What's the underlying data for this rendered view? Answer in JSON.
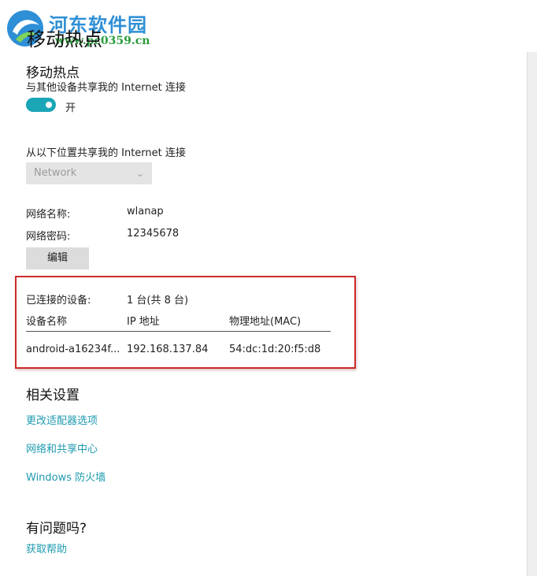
{
  "watermark": {
    "site_name": "河东软件园",
    "url": "www.pc0359.cn"
  },
  "page": {
    "title": "移动热点"
  },
  "hotspot": {
    "section_title": "移动热点",
    "share_label": "与其他设备共享我的 Internet 连接",
    "toggle_state": "开",
    "share_from_label": "从以下位置共享我的 Internet 连接",
    "share_from_value": "Network"
  },
  "network": {
    "name_label": "网络名称:",
    "name_value": "wlanap",
    "password_label": "网络密码:",
    "password_value": "12345678",
    "edit_button": "编辑"
  },
  "devices": {
    "connected_label": "已连接的设备:",
    "connected_value": "1 台(共 8 台)",
    "headers": [
      "设备名称",
      "IP 地址",
      "物理地址(MAC)"
    ],
    "rows": [
      [
        "android-a16234f...",
        "192.168.137.84",
        "54:dc:1d:20:f5:d8"
      ]
    ]
  },
  "related": {
    "title": "相关设置",
    "links": [
      "更改适配器选项",
      "网络和共享中心",
      "Windows 防火墙"
    ]
  },
  "help": {
    "title": "有问题吗?",
    "link": "获取帮助"
  },
  "colors": {
    "accent": "#1aa6b7",
    "link": "#1e9ab0",
    "highlight": "#cc2b2b"
  }
}
